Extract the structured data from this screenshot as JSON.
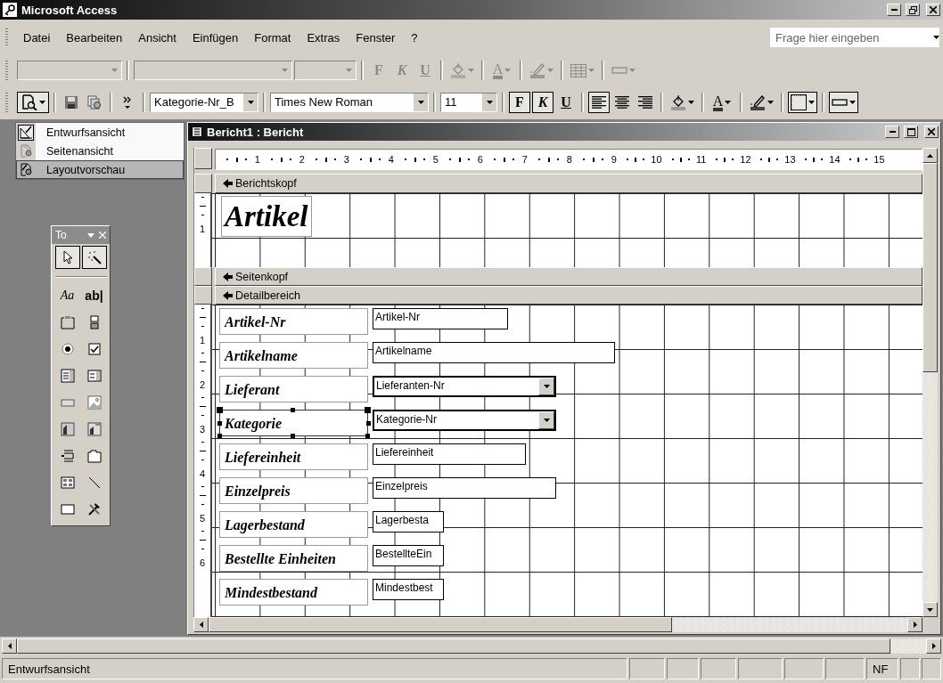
{
  "app": {
    "title": "Microsoft Access"
  },
  "menu": [
    {
      "label": "Datei"
    },
    {
      "label": "Bearbeiten"
    },
    {
      "label": "Ansicht"
    },
    {
      "label": "Einfügen"
    },
    {
      "label": "Format"
    },
    {
      "label": "Extras"
    },
    {
      "label": "Fenster"
    },
    {
      "label": "?"
    }
  ],
  "help_search": {
    "placeholder": "Frage hier eingeben"
  },
  "toolbar_1": [
    {
      "kind": "combo",
      "disabled": true
    },
    {
      "kind": "combo",
      "disabled": true
    },
    {
      "kind": "combo",
      "disabled": true
    },
    {
      "kind": "toggle",
      "label": "F",
      "disabled": true,
      "pressed": false
    },
    {
      "kind": "toggle",
      "label": "K",
      "disabled": true,
      "pressed": false
    },
    {
      "kind": "toggle",
      "label": "U",
      "disabled": true,
      "pressed": false
    },
    {
      "kind": "fill",
      "disabled": true
    },
    {
      "kind": "fontcolor",
      "label": "A",
      "disabled": true
    },
    {
      "kind": "linecolor",
      "disabled": true
    },
    {
      "kind": "grid",
      "disabled": true
    },
    {
      "kind": "linestyle",
      "disabled": true
    }
  ],
  "toolbar_2": [
    {
      "kind": "view",
      "disabled": false
    },
    {
      "kind": "save",
      "disabled": false
    },
    {
      "kind": "pages",
      "disabled": false
    },
    {
      "kind": "overflow",
      "disabled": false
    },
    {
      "kind": "combo",
      "value": "Kategorie-Nr_B",
      "disabled": false
    },
    {
      "kind": "combo",
      "value": "Times New Roman",
      "disabled": false
    },
    {
      "kind": "combo",
      "value": "11",
      "disabled": false
    },
    {
      "kind": "toggle",
      "label": "F",
      "disabled": false,
      "pressed": true
    },
    {
      "kind": "toggle",
      "label": "K",
      "disabled": false,
      "pressed": true
    },
    {
      "kind": "toggle",
      "label": "U",
      "disabled": false,
      "pressed": false
    },
    {
      "kind": "align_left",
      "disabled": false,
      "pressed": true
    },
    {
      "kind": "align_center",
      "disabled": false,
      "pressed": false
    },
    {
      "kind": "align_right",
      "disabled": false,
      "pressed": false
    },
    {
      "kind": "fill",
      "disabled": false
    },
    {
      "kind": "fontcolor",
      "label": "A",
      "disabled": false
    },
    {
      "kind": "linecolor",
      "disabled": false
    },
    {
      "kind": "border",
      "disabled": false
    },
    {
      "kind": "linestyle",
      "disabled": false
    }
  ],
  "view_menu": [
    {
      "kind": "design",
      "label": "Entwurfsansicht",
      "checked": true,
      "selected": false
    },
    {
      "kind": "preview",
      "label": "Seitenansicht",
      "checked": false,
      "selected": false
    },
    {
      "kind": "layout",
      "label": "Layoutvorschau",
      "checked": false,
      "selected": true
    }
  ],
  "toolbox": {
    "title": "To",
    "tools": [
      {
        "kind": "pointer",
        "pressed": true
      },
      {
        "kind": "wizard",
        "pressed": true
      },
      {
        "kind": "label",
        "text": "Aa",
        "pressed": false
      },
      {
        "kind": "textbox",
        "text": "ab|",
        "pressed": false
      },
      {
        "kind": "optiongroup",
        "pressed": false
      },
      {
        "kind": "togglebutton",
        "pressed": false
      },
      {
        "kind": "radio",
        "pressed": false
      },
      {
        "kind": "checkbox",
        "pressed": false
      },
      {
        "kind": "combobox",
        "pressed": false
      },
      {
        "kind": "listbox",
        "pressed": false
      },
      {
        "kind": "button",
        "pressed": false
      },
      {
        "kind": "image",
        "pressed": false
      },
      {
        "kind": "unbound",
        "pressed": false
      },
      {
        "kind": "bound",
        "pressed": false
      },
      {
        "kind": "pagebreak",
        "pressed": false
      },
      {
        "kind": "tabcontrol",
        "pressed": false
      },
      {
        "kind": "subform",
        "pressed": false
      },
      {
        "kind": "line",
        "pressed": false
      },
      {
        "kind": "rectangle",
        "pressed": false
      },
      {
        "kind": "more",
        "pressed": false
      }
    ]
  },
  "report": {
    "title": "Bericht1 : Bericht",
    "ruler": [
      "1",
      "2",
      "3",
      "4",
      "5",
      "6",
      "7",
      "8",
      "9",
      "10",
      "11",
      "12",
      "13",
      "14",
      "15"
    ],
    "sections": [
      {
        "kind": "report_header",
        "title": "Berichtskopf",
        "ruler": [
          "1"
        ],
        "heading": "Artikel"
      },
      {
        "kind": "page_header",
        "title": "Seitenkopf"
      },
      {
        "kind": "detail",
        "title": "Detailbereich",
        "ruler": [
          "1",
          "2",
          "3",
          "4",
          "5",
          "6"
        ],
        "rows": [
          {
            "label": "Artikel-Nr",
            "field": "Artikel-Nr",
            "kind": "textbox",
            "selected": false
          },
          {
            "label": "Artikelname",
            "field": "Artikelname",
            "kind": "textbox",
            "selected": false
          },
          {
            "label": "Lieferant",
            "field": "Lieferanten-Nr",
            "kind": "combobox",
            "selected": false
          },
          {
            "label": "Kategorie",
            "field": "Kategorie-Nr",
            "kind": "combobox",
            "selected": true
          },
          {
            "label": "Liefereinheit",
            "field": "Liefereinheit",
            "kind": "textbox",
            "selected": false
          },
          {
            "label": "Einzelpreis",
            "field": "Einzelpreis",
            "kind": "textbox",
            "selected": false
          },
          {
            "label": "Lagerbestand",
            "field": "Lagerbesta",
            "kind": "textbox",
            "selected": false
          },
          {
            "label": "Bestellte Einheiten",
            "field": "BestellteEin",
            "kind": "textbox",
            "selected": false
          },
          {
            "label": "Mindestbestand",
            "field": "Mindestbest",
            "kind": "textbox",
            "selected": false
          }
        ]
      }
    ]
  },
  "status_bar": {
    "text": "Entwurfsansicht",
    "indicators": [
      "NF"
    ]
  }
}
